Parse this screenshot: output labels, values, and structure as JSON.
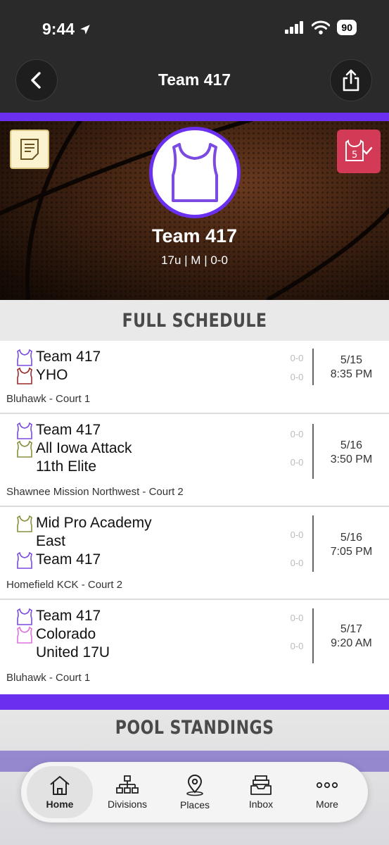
{
  "status_bar": {
    "time": "9:44",
    "battery": "90"
  },
  "header": {
    "title": "Team 417"
  },
  "hero": {
    "team_name": "Team 417",
    "subtitle": "17u | M | 0-0"
  },
  "schedule": {
    "heading": "FULL SCHEDULE",
    "games": [
      {
        "teams": [
          {
            "name": "Team 417",
            "jersey_color": "#7b4ae0",
            "score": "0-0"
          },
          {
            "name": "YHO",
            "jersey_color": "#9a2a2a",
            "score": "0-0"
          }
        ],
        "date": "5/15",
        "time": "8:35 PM",
        "location": "Bluhawk - Court 1"
      },
      {
        "teams": [
          {
            "name": "Team 417",
            "jersey_color": "#7b4ae0",
            "score": "0-0"
          },
          {
            "name": "All Iowa Attack 11th Elite",
            "lines": [
              "All Iowa Attack",
              "11th Elite"
            ],
            "jersey_color": "#8a8f3a",
            "score": "0-0"
          }
        ],
        "date": "5/16",
        "time": "3:50 PM",
        "location": "Shawnee Mission Northwest - Court 2"
      },
      {
        "teams": [
          {
            "name": "Mid Pro Academy East",
            "lines": [
              "Mid Pro Academy",
              "East"
            ],
            "jersey_color": "#8a8f3a",
            "score": "0-0"
          },
          {
            "name": "Team 417",
            "jersey_color": "#7b4ae0",
            "score": "0-0"
          }
        ],
        "date": "5/16",
        "time": "7:05 PM",
        "location": "Homefield KCK - Court 2"
      },
      {
        "teams": [
          {
            "name": "Team 417",
            "jersey_color": "#7b4ae0",
            "score": "0-0"
          },
          {
            "name": "Colorado United 17U",
            "lines": [
              "Colorado",
              "United 17U"
            ],
            "jersey_color": "#e070e0",
            "score": "0-0"
          }
        ],
        "date": "5/17",
        "time": "9:20 AM",
        "location": "Bluhawk - Court 1"
      }
    ]
  },
  "standings": {
    "heading": "POOL STANDINGS"
  },
  "tab_bar": {
    "items": [
      {
        "label": "Home",
        "icon": "home-icon",
        "active": true
      },
      {
        "label": "Divisions",
        "icon": "divisions-icon",
        "active": false
      },
      {
        "label": "Places",
        "icon": "places-icon",
        "active": false
      },
      {
        "label": "Inbox",
        "icon": "inbox-icon",
        "active": false
      },
      {
        "label": "More",
        "icon": "more-icon",
        "active": false
      }
    ]
  },
  "colors": {
    "accent": "#6b2ff0",
    "header_bg": "#2a2a2a",
    "favorite_bg": "#d23a55",
    "notes_bg": "#fbf3d0"
  }
}
